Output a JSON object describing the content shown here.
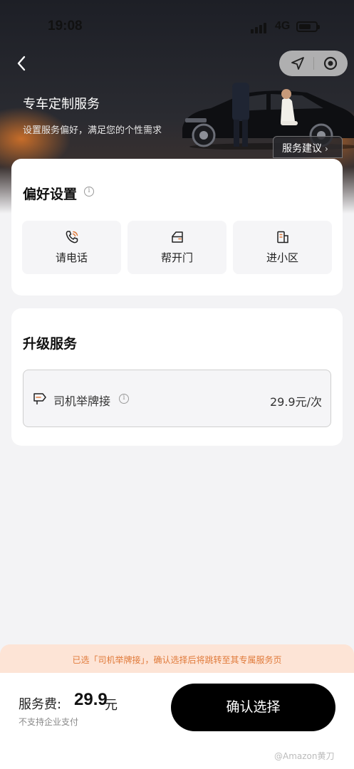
{
  "status": {
    "time": "19:08",
    "network": "4G"
  },
  "header": {
    "title": "专车定制服务",
    "subtitle": "设置服务偏好，满足您的个性需求",
    "advice_label": "服务建议",
    "advice_chevron": "›"
  },
  "preferences": {
    "title": "偏好设置",
    "items": [
      {
        "label": "请电话",
        "icon": "phone-icon"
      },
      {
        "label": "帮开门",
        "icon": "car-door-icon"
      },
      {
        "label": "进小区",
        "icon": "building-gate-icon"
      }
    ]
  },
  "upgrade": {
    "title": "升级服务",
    "service": {
      "name": "司机举牌接",
      "price": "29.9元/次",
      "icon": "signboard-icon"
    }
  },
  "notice": "已选「司机举牌接」，确认选择后将跳转至其专属服务页",
  "footer": {
    "fee_label": "服务费:",
    "fee_value": "29.9",
    "fee_unit": "元",
    "fee_note": "不支持企业支付",
    "confirm_label": "确认选择"
  },
  "watermark": "@Amazon黄刀",
  "colors": {
    "accent_orange": "#e07a3a",
    "notice_bg": "#fde4d6",
    "button_bg": "#000000"
  }
}
